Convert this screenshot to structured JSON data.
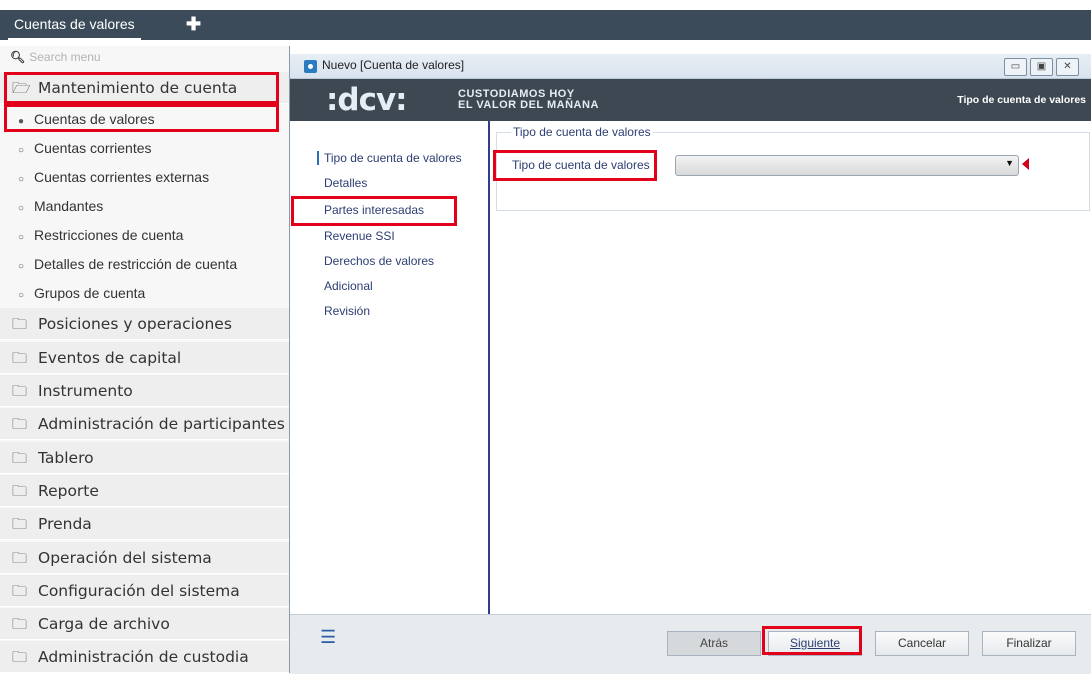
{
  "top": {
    "tab_label": "Cuentas de valores",
    "add_icon": "plus-icon"
  },
  "sidebar": {
    "search_placeholder": "Search menu",
    "sections": [
      {
        "label": "Mantenimiento de cuenta",
        "expanded": true
      },
      {
        "label": "Posiciones y operaciones"
      },
      {
        "label": "Eventos de capital"
      },
      {
        "label": "Instrumento"
      },
      {
        "label": "Administración de participantes"
      },
      {
        "label": "Tablero"
      },
      {
        "label": "Reporte"
      },
      {
        "label": "Prenda"
      },
      {
        "label": "Operación del sistema"
      },
      {
        "label": "Configuración del sistema"
      },
      {
        "label": "Carga de archivo"
      },
      {
        "label": "Administración de custodia"
      }
    ],
    "subitems": [
      {
        "label": "Cuentas de valores",
        "active": true
      },
      {
        "label": "Cuentas corrientes"
      },
      {
        "label": "Cuentas corrientes externas"
      },
      {
        "label": "Mandantes"
      },
      {
        "label": "Restricciones de cuenta"
      },
      {
        "label": "Detalles de restricción de cuenta"
      },
      {
        "label": "Grupos de cuenta"
      }
    ]
  },
  "window": {
    "title": "Nuevo [Cuenta de valores]",
    "banner": {
      "logo": ":dcv:",
      "tagline_1": "CUSTODIAMOS HOY",
      "tagline_2": "EL VALOR DEL MAÑANA",
      "right_title": "Tipo de cuenta de valores"
    },
    "steps": [
      "Tipo de cuenta de valores",
      "Detalles",
      "Partes interesadas",
      "Revenue SSI",
      "Derechos de valores",
      "Adicional",
      "Revisión"
    ],
    "form": {
      "legend": "Tipo de cuenta de valores",
      "field_label": "Tipo de cuenta de valores",
      "field_value": ""
    },
    "footer": {
      "back": "Atrás",
      "next": "Siguiente",
      "cancel": "Cancelar",
      "finish": "Finalizar"
    }
  },
  "colors": {
    "highlight": "#e3001b",
    "topbar": "#3c4b5a",
    "banner": "#3d4852"
  }
}
